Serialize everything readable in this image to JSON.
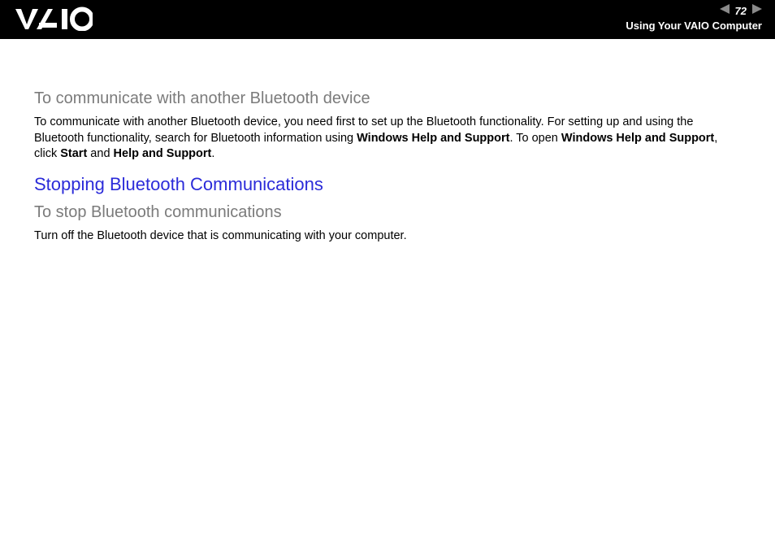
{
  "header": {
    "page_number": "72",
    "section": "Using Your VAIO Computer"
  },
  "content": {
    "sub1": "To communicate with another Bluetooth device",
    "para1_a": "To communicate with another Bluetooth device, you need first to set up the Bluetooth functionality. For setting up and using the Bluetooth functionality, search for Bluetooth information using ",
    "para1_b1": "Windows Help and Support",
    "para1_c": ". To open ",
    "para1_b2": "Windows Help and Support",
    "para1_d": ", click ",
    "para1_b3": "Start",
    "para1_e": " and ",
    "para1_b4": "Help and Support",
    "para1_f": ".",
    "title2": "Stopping Bluetooth Communications",
    "sub2": "To stop Bluetooth communications",
    "para2": "Turn off the Bluetooth device that is communicating with your computer."
  }
}
